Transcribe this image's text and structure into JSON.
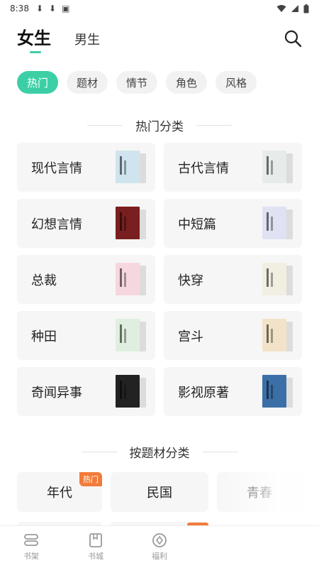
{
  "status_bar": {
    "time": "8:38"
  },
  "header": {
    "tab_female": "女生",
    "tab_male": "男生"
  },
  "chips": [
    {
      "label": "热门",
      "active": true
    },
    {
      "label": "题材",
      "active": false
    },
    {
      "label": "情节",
      "active": false
    },
    {
      "label": "角色",
      "active": false
    },
    {
      "label": "风格",
      "active": false
    }
  ],
  "hot_section": {
    "title": "热门分类",
    "categories": [
      {
        "label": "现代言情",
        "cover_color": "#cfe4ee"
      },
      {
        "label": "古代言情",
        "cover_color": "#e6ecea"
      },
      {
        "label": "幻想言情",
        "cover_color": "#7a1f1f"
      },
      {
        "label": "中短篇",
        "cover_color": "#dfe2f3"
      },
      {
        "label": "总裁",
        "cover_color": "#f6d7e0"
      },
      {
        "label": "快穿",
        "cover_color": "#f2efe2"
      },
      {
        "label": "种田",
        "cover_color": "#dfeee0"
      },
      {
        "label": "宫斗",
        "cover_color": "#f2e3c8"
      },
      {
        "label": "奇闻异事",
        "cover_color": "#222222"
      },
      {
        "label": "影视原著",
        "cover_color": "#3c6fa8"
      }
    ]
  },
  "theme_section": {
    "title": "按题材分类",
    "items": [
      {
        "label": "年代",
        "tag": "热门"
      },
      {
        "label": "民国",
        "tag": ""
      },
      {
        "label": "青春",
        "tag": ""
      }
    ]
  },
  "bottom_nav": {
    "shelf": "书架",
    "store": "书城",
    "welfare": "福利"
  },
  "colors": {
    "accent": "#3ccfa6",
    "hot_tag": "#f27b3a"
  }
}
